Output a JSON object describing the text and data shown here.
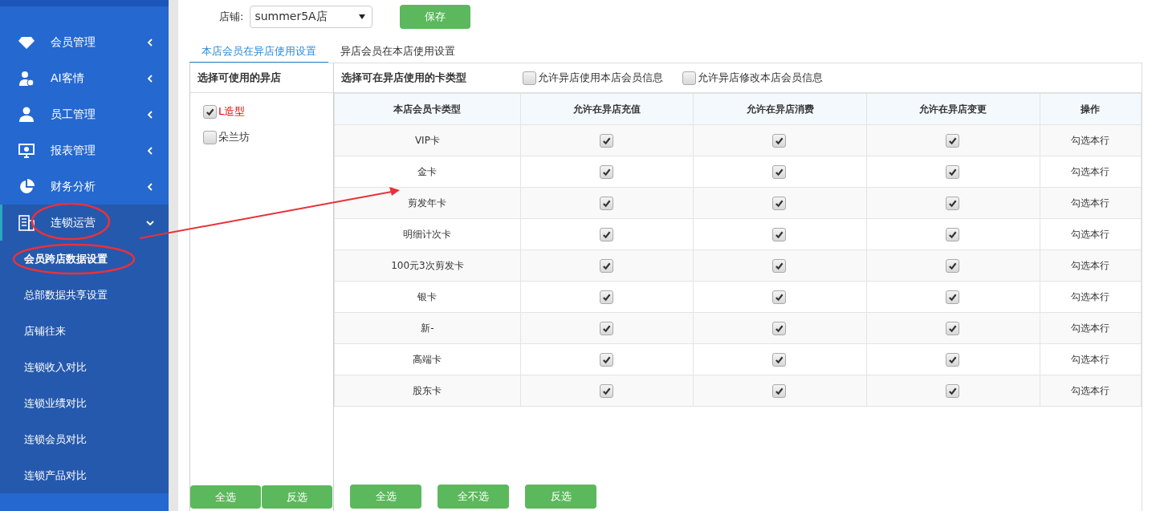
{
  "sidebar": {
    "items": [
      {
        "label": "会员管理",
        "kind": "diamond",
        "expanded": false
      },
      {
        "label": "AI客情",
        "kind": "person",
        "expanded": false
      },
      {
        "label": "员工管理",
        "kind": "user",
        "expanded": false
      },
      {
        "label": "报表管理",
        "kind": "monitor",
        "expanded": false
      },
      {
        "label": "财务分析",
        "kind": "pie",
        "expanded": false
      },
      {
        "label": "连锁运营",
        "kind": "building",
        "expanded": true,
        "children": [
          {
            "label": "会员跨店数据设置",
            "selected": true
          },
          {
            "label": "总部数据共享设置",
            "selected": false
          },
          {
            "label": "店铺往来",
            "selected": false
          },
          {
            "label": "连锁收入对比",
            "selected": false
          },
          {
            "label": "连锁业绩对比",
            "selected": false
          },
          {
            "label": "连锁会员对比",
            "selected": false
          },
          {
            "label": "连锁产品对比",
            "selected": false
          }
        ]
      }
    ]
  },
  "store": {
    "label": "店铺:",
    "value": "summer5A店"
  },
  "save_button": "保存",
  "tabs": [
    {
      "label": "本店会员在异店使用设置",
      "selected": true
    },
    {
      "label": "异店会员在本店使用设置",
      "selected": false
    }
  ],
  "stores_panel": {
    "title": "选择可使用的异店",
    "stores": [
      {
        "label": "L造型",
        "checked": true
      },
      {
        "label": "朵兰坊",
        "checked": false
      }
    ],
    "buttons": [
      "全选",
      "反选"
    ]
  },
  "cards_panel": {
    "title": "选择可在异店使用的卡类型",
    "options": [
      {
        "label": "允许异店使用本店会员信息",
        "checked": false
      },
      {
        "label": "允许异店修改本店会员信息",
        "checked": false
      }
    ],
    "columns": [
      "本店会员卡类型",
      "允许在异店充值",
      "允许在异店消费",
      "允许在异店变更",
      "操作"
    ],
    "rows": [
      {
        "name": "VIP卡",
        "recharge": true,
        "consume": true,
        "change": true,
        "action": "勾选本行"
      },
      {
        "name": "金卡",
        "recharge": true,
        "consume": true,
        "change": true,
        "action": "勾选本行"
      },
      {
        "name": "剪发年卡",
        "recharge": true,
        "consume": true,
        "change": true,
        "action": "勾选本行"
      },
      {
        "name": "明细计次卡",
        "recharge": true,
        "consume": true,
        "change": true,
        "action": "勾选本行"
      },
      {
        "name": "100元3次剪发卡",
        "recharge": true,
        "consume": true,
        "change": true,
        "action": "勾选本行"
      },
      {
        "name": "银卡",
        "recharge": true,
        "consume": true,
        "change": true,
        "action": "勾选本行"
      },
      {
        "name": "新-",
        "recharge": true,
        "consume": true,
        "change": true,
        "action": "勾选本行"
      },
      {
        "name": "高端卡",
        "recharge": true,
        "consume": true,
        "change": true,
        "action": "勾选本行"
      },
      {
        "name": "股东卡",
        "recharge": true,
        "consume": true,
        "change": true,
        "action": "勾选本行"
      }
    ],
    "buttons": [
      "全选",
      "全不选",
      "反选"
    ]
  }
}
